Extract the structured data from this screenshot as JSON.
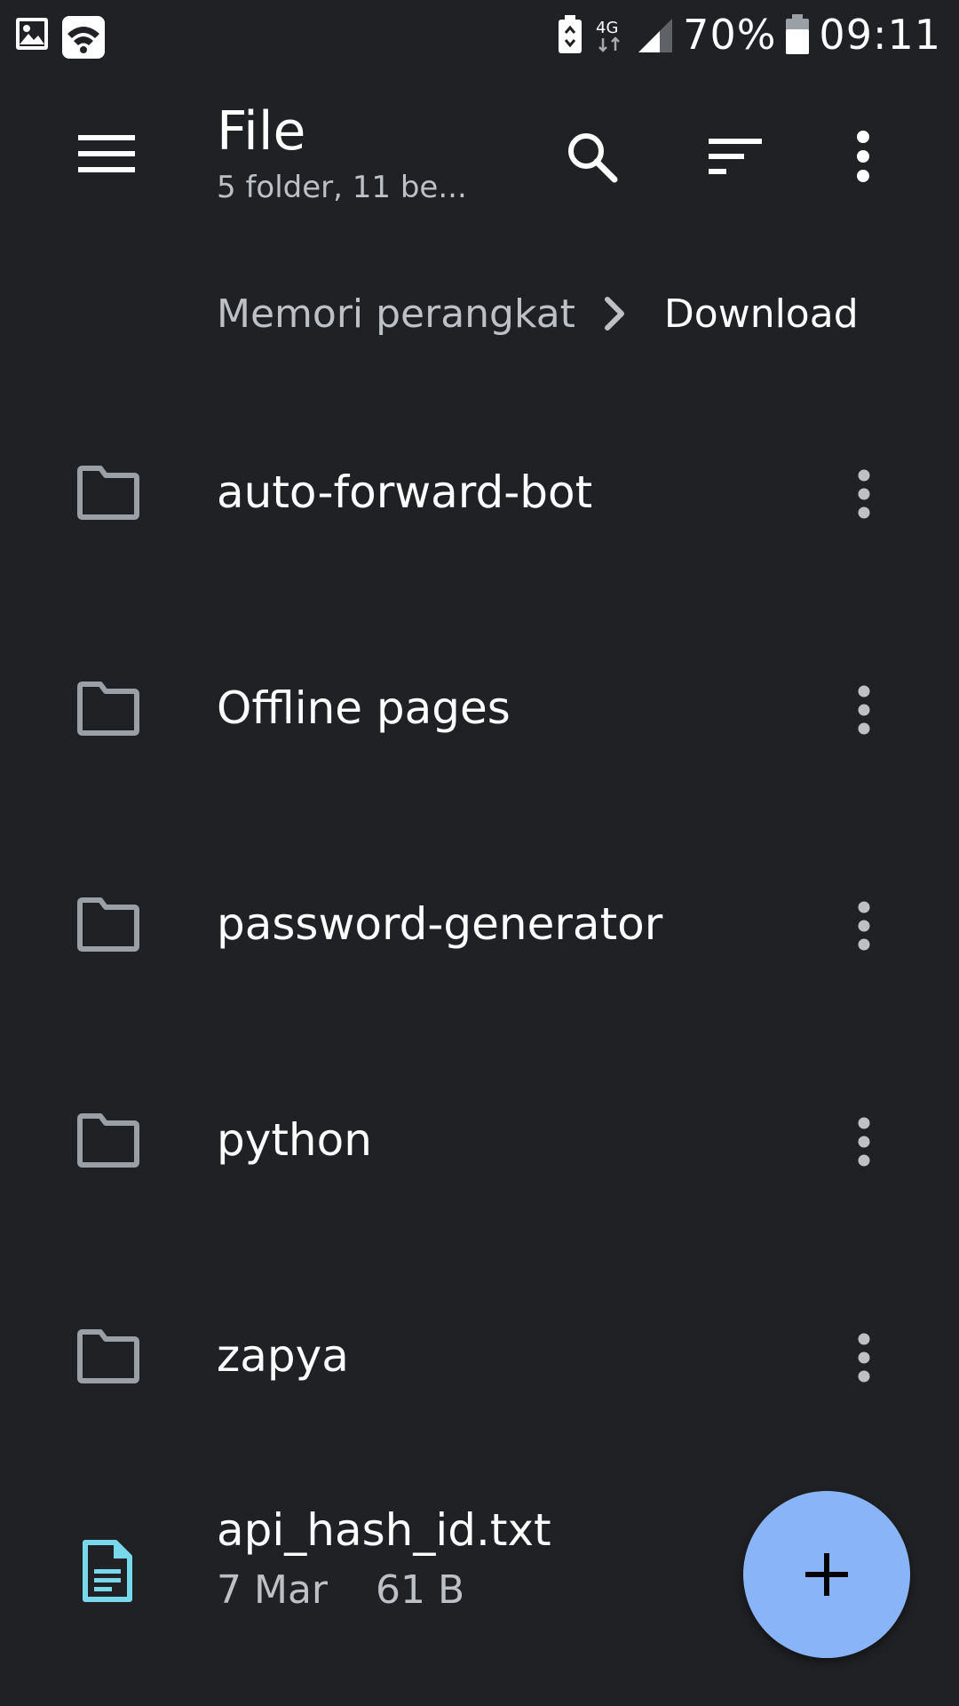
{
  "status_bar": {
    "network": "4G",
    "battery_percent": "70%",
    "time": "09:11"
  },
  "app_bar": {
    "title": "File",
    "subtitle": "5 folder, 11 be..."
  },
  "breadcrumb": {
    "parent": "Memori perangkat",
    "current": "Download"
  },
  "folders": [
    {
      "name": "auto-forward-bot"
    },
    {
      "name": "Offline pages"
    },
    {
      "name": "password-generator"
    },
    {
      "name": "python"
    },
    {
      "name": "zapya"
    }
  ],
  "files": [
    {
      "name": "api_hash_id.txt",
      "date": "7 Mar",
      "size": "61 B"
    }
  ],
  "colors": {
    "background": "#202124",
    "fab": "#8ab4f8",
    "file_icon": "#78d9ec",
    "secondary_text": "#bdc1c6"
  }
}
